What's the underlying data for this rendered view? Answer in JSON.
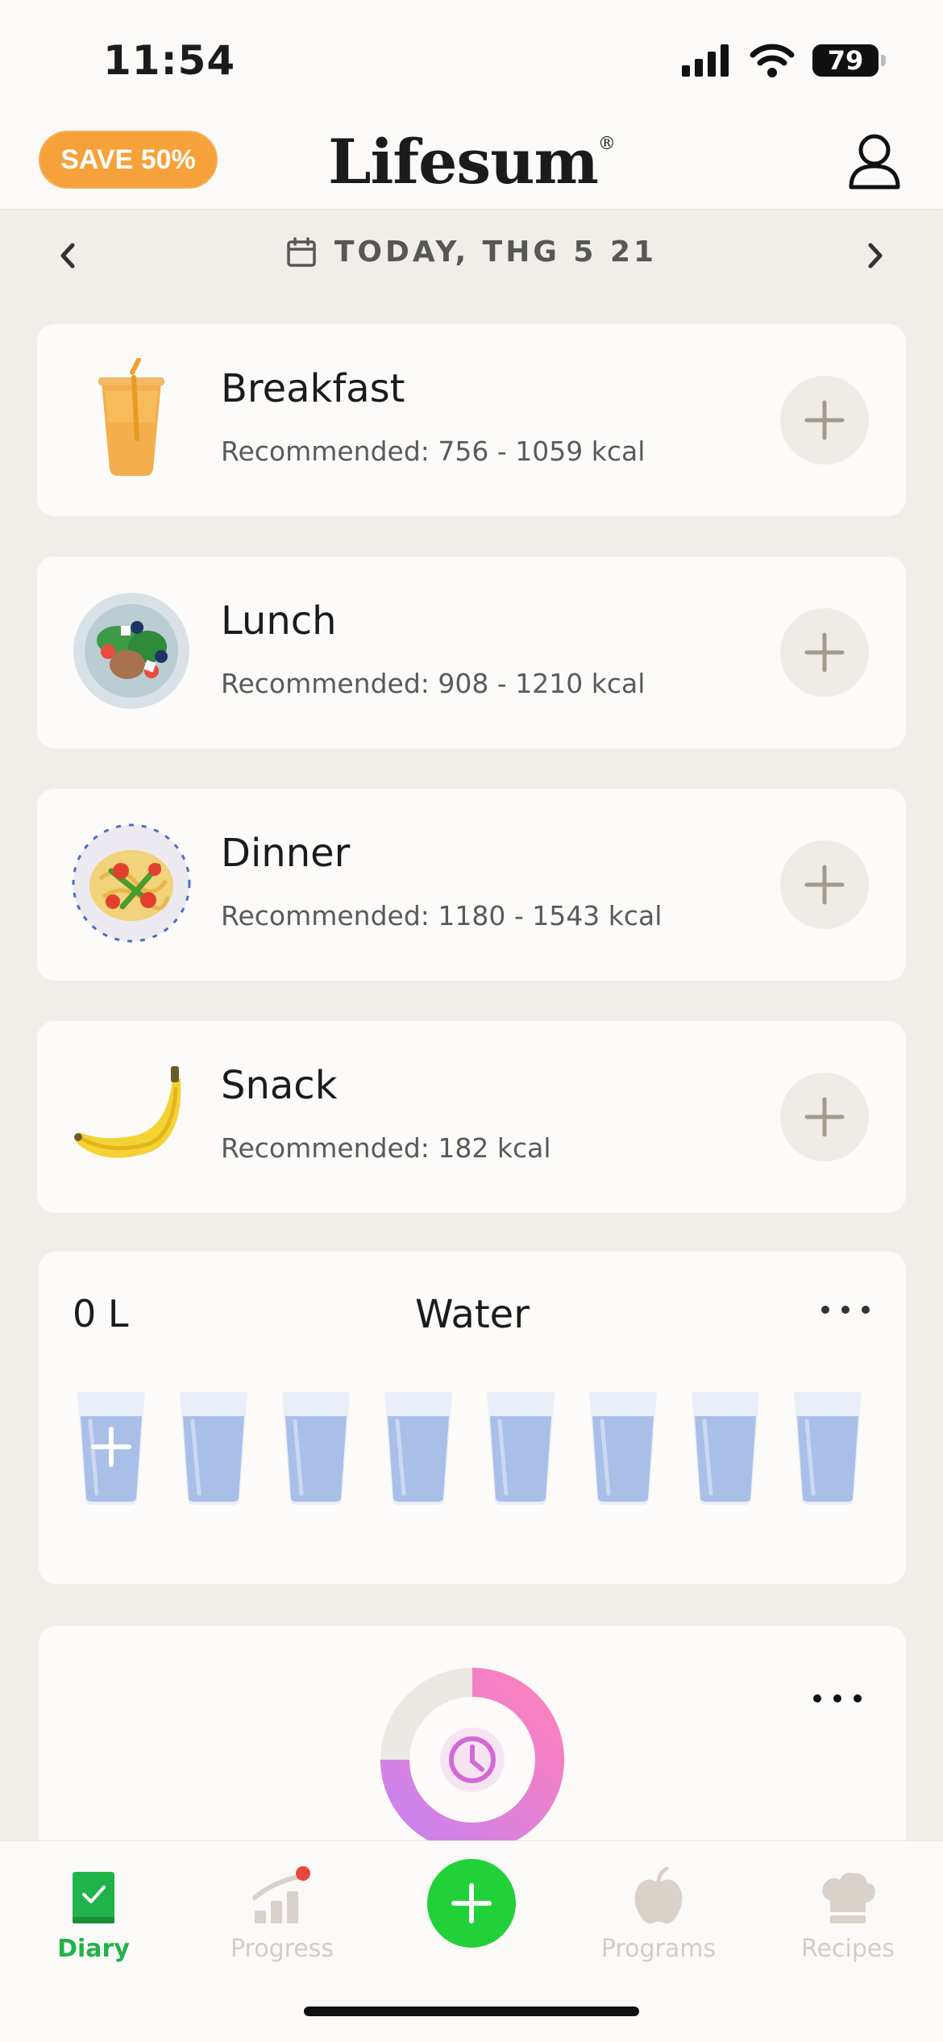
{
  "status_bar": {
    "time": "11:54",
    "battery": "79"
  },
  "header": {
    "promo_label": "SAVE 50%",
    "logo_text": "Lifesum",
    "logo_mark": "®"
  },
  "date_nav": {
    "label": "TODAY, THG 5 21"
  },
  "meals": [
    {
      "title": "Breakfast",
      "recommended": "Recommended: 756 - 1059  kcal",
      "image": "orange-juice"
    },
    {
      "title": "Lunch",
      "recommended": "Recommended: 908 - 1210  kcal",
      "image": "salad-plate"
    },
    {
      "title": "Dinner",
      "recommended": "Recommended: 1180 - 1543  kcal",
      "image": "pasta-plate"
    },
    {
      "title": "Snack",
      "recommended": "Recommended: 182  kcal",
      "image": "banana"
    }
  ],
  "water": {
    "amount": "0 L",
    "title": "Water",
    "glasses_total": 8,
    "glasses_filled": 0
  },
  "fasting": {
    "icon": "clock-icon"
  },
  "tabs": [
    {
      "label": "Diary",
      "icon": "diary-icon",
      "active": true
    },
    {
      "label": "Progress",
      "icon": "progress-icon",
      "active": false
    },
    {
      "label": "Programs",
      "icon": "apple-icon",
      "active": false
    },
    {
      "label": "Recipes",
      "icon": "chef-hat-icon",
      "active": false
    }
  ],
  "colors": {
    "accent_green": "#22d13a",
    "promo_orange": "#f6a139",
    "background": "#f1eeea",
    "card": "#fcfbf9"
  }
}
